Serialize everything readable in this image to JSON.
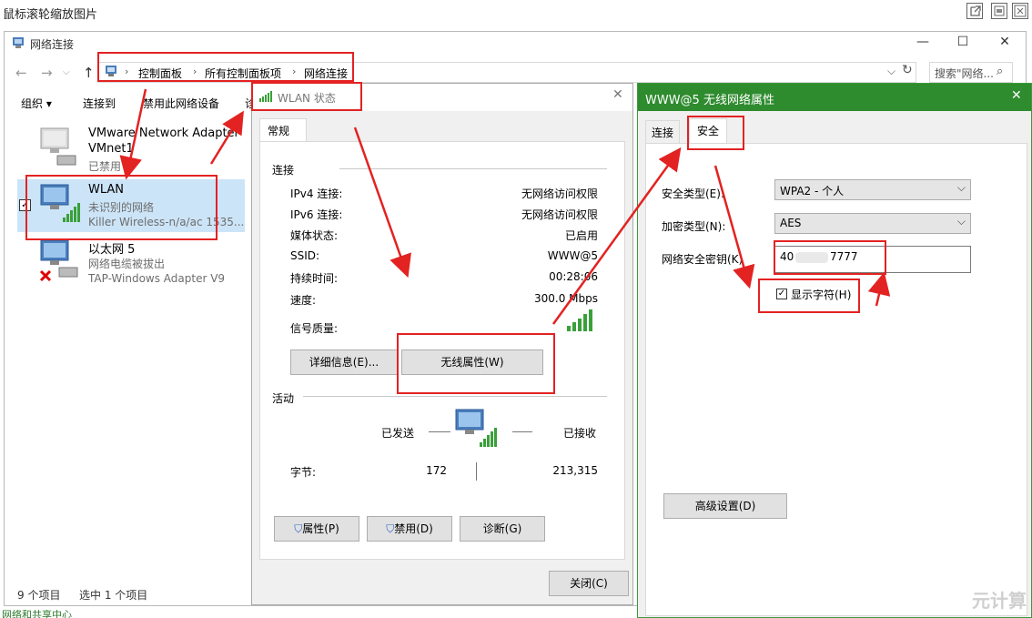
{
  "viewer": {
    "title": "鼠标滚轮缩放图片"
  },
  "explorer": {
    "title": "网络连接",
    "breadcrumb": [
      "控制面板",
      "所有控制面板项",
      "网络连接"
    ],
    "search_placeholder": "搜索\"网络...",
    "toolbar": [
      "组织 ▾",
      "连接到",
      "禁用此网络设备",
      "诊"
    ],
    "connections": [
      {
        "name": "VMware Network Adapter",
        "name2": "VMnet1",
        "status": "已禁用",
        "adapter": ""
      },
      {
        "name": "WLAN",
        "status": "未识别的网络",
        "adapter": "Killer Wireless-n/a/ac 1535..."
      },
      {
        "name": "以太网 5",
        "status": "网络电缆被拔出",
        "adapter": "TAP-Windows Adapter V9"
      }
    ],
    "status_bar": {
      "items": "9 个项目",
      "selected": "选中 1 个项目"
    },
    "footer_partial": "网络和共享中心"
  },
  "wlan_dialog": {
    "title": "WLAN 状态",
    "tab": "常规",
    "section_connection": "连接",
    "rows": [
      {
        "k": "IPv4 连接:",
        "v": "无网络访问权限"
      },
      {
        "k": "IPv6 连接:",
        "v": "无网络访问权限"
      },
      {
        "k": "媒体状态:",
        "v": "已启用"
      },
      {
        "k": "SSID:",
        "v": "WWW@5"
      },
      {
        "k": "持续时间:",
        "v": "00:28:06"
      },
      {
        "k": "速度:",
        "v": "300.0 Mbps"
      }
    ],
    "signal_label": "信号质量:",
    "btn_details": "详细信息(E)...",
    "btn_wireless": "无线属性(W)",
    "section_activity": "活动",
    "sent_label": "已发送",
    "recv_label": "已接收",
    "bytes_label": "字节:",
    "bytes_sent": "172",
    "bytes_recv": "213,315",
    "btn_properties": "属性(P)",
    "btn_disable": "禁用(D)",
    "btn_diagnose": "诊断(G)",
    "btn_close": "关闭(C)"
  },
  "prop_dialog": {
    "title": "WWW@5 无线网络属性",
    "tab_connection": "连接",
    "tab_security": "安全",
    "security_type_label": "安全类型(E):",
    "security_type_value": "WPA2 - 个人",
    "encryption_label": "加密类型(N):",
    "encryption_value": "AES",
    "key_label": "网络安全密钥(K)",
    "key_value_a": "40",
    "key_value_b": "7777",
    "show_chars_label": "显示字符(H)",
    "show_chars_checked": true,
    "btn_advanced": "高级设置(D)"
  },
  "watermark": "元计算",
  "colors": {
    "annotation_red": "#e32222",
    "prop_title_green": "#2e8b2e"
  }
}
